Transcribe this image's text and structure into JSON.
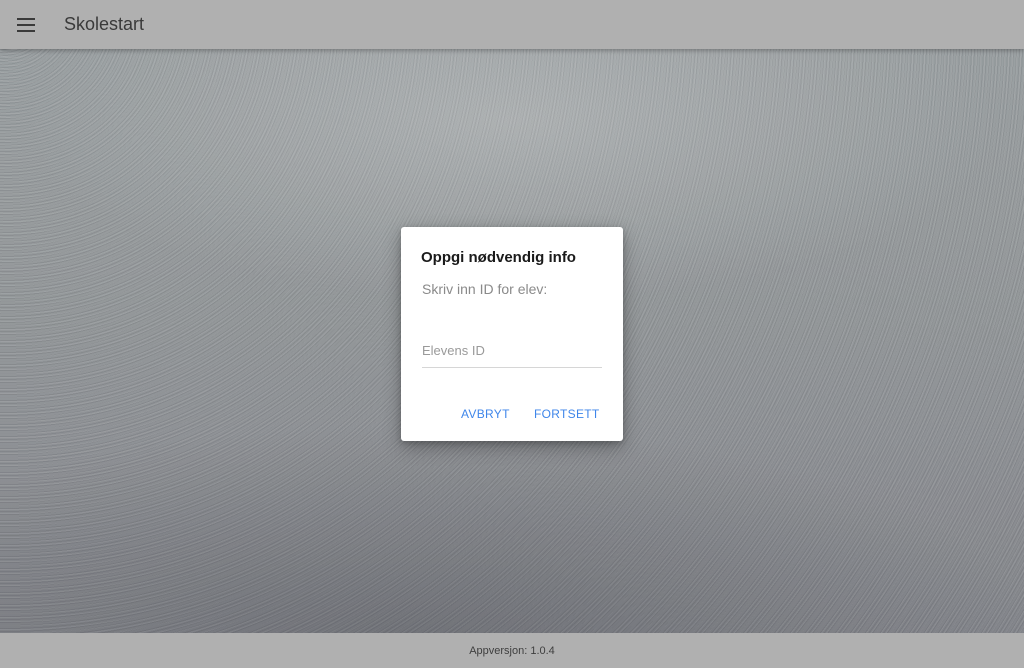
{
  "appbar": {
    "title": "Skolestart",
    "menu_icon": "menu-icon"
  },
  "dialog": {
    "title": "Oppgi nødvendig info",
    "text": "Skriv inn ID for elev:",
    "input": {
      "value": "",
      "placeholder": "Elevens ID"
    },
    "cancel_label": "AVBRYT",
    "continue_label": "FORTSETT"
  },
  "footer": {
    "version_text": "Appversjon: 1.0.4"
  },
  "colors": {
    "accent": "#3f86ea",
    "appbar": "#b0b0b0"
  }
}
